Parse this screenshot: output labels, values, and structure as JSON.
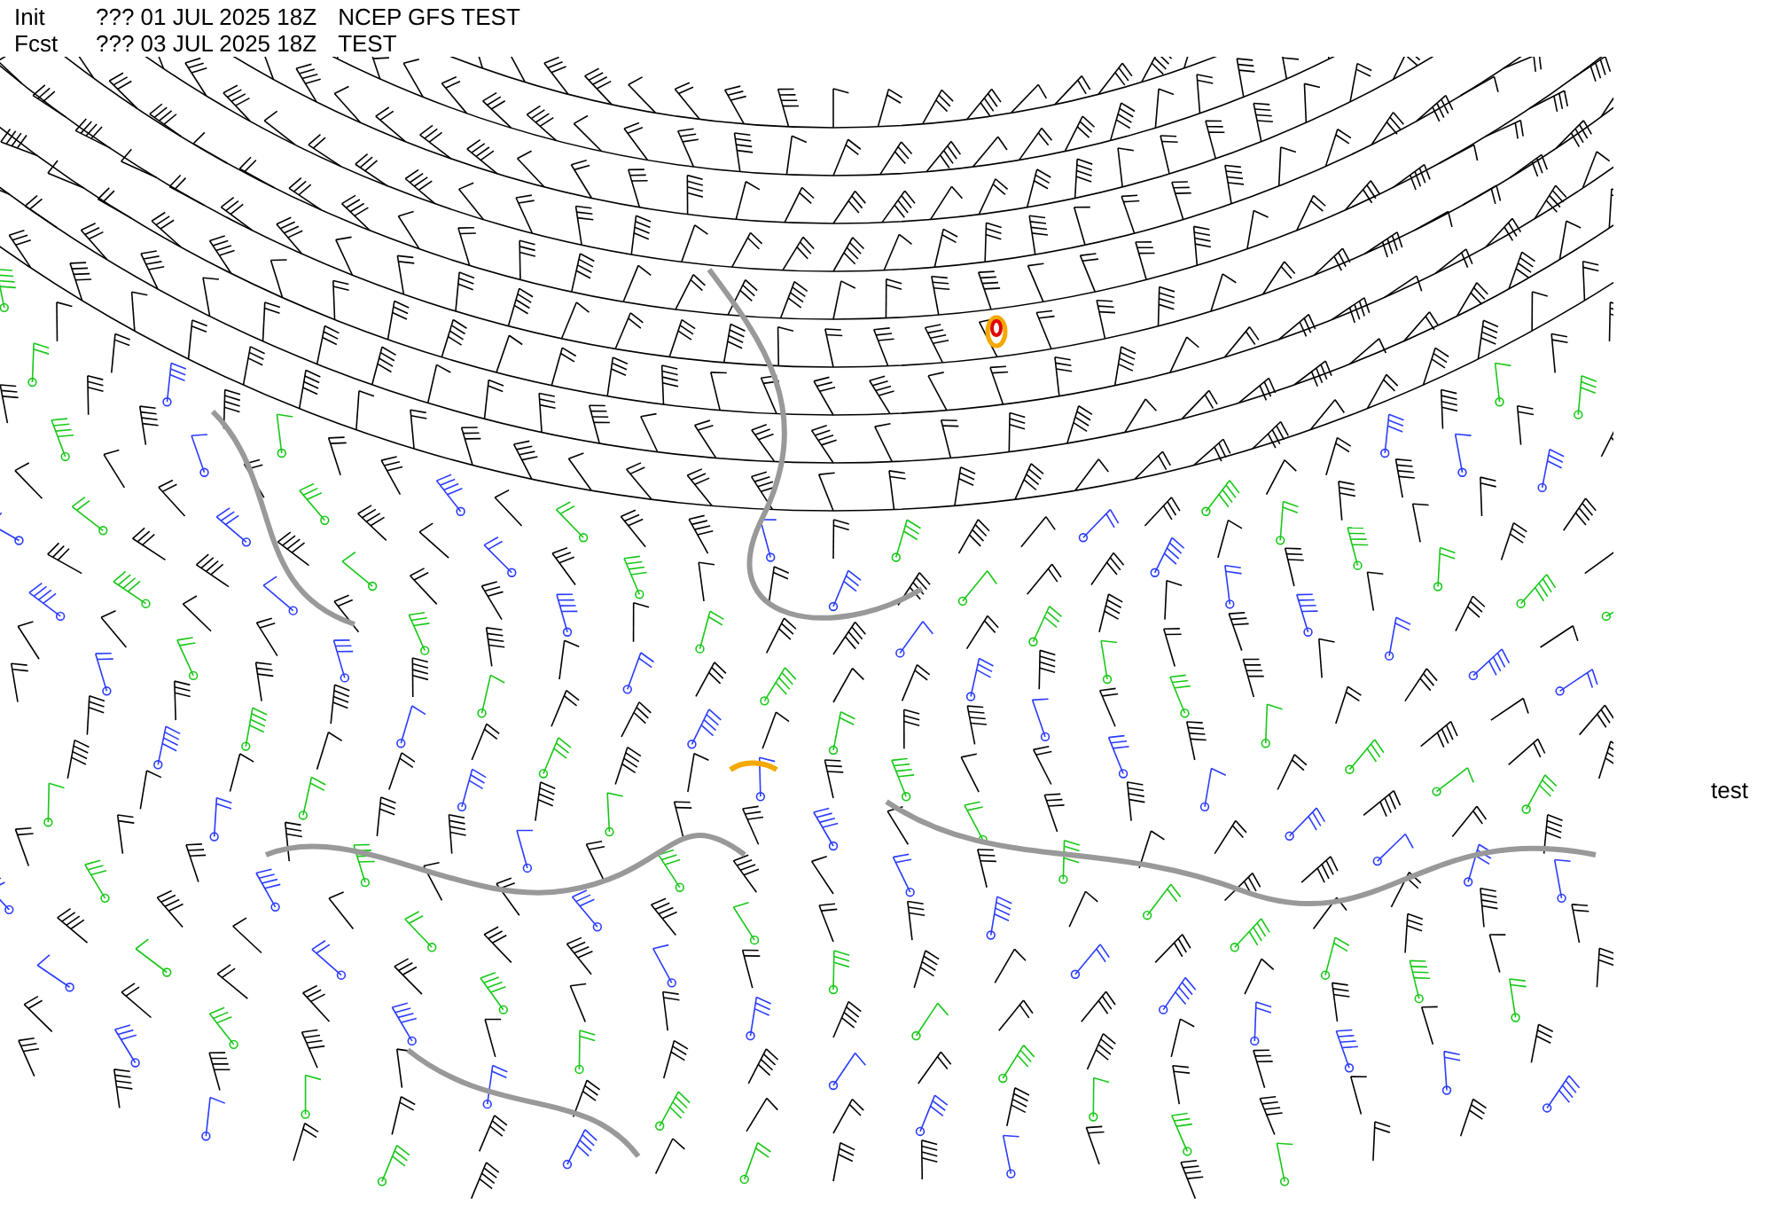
{
  "header": {
    "lines": [
      [
        "Init",
        "??? 01 JUL 2025 18Z",
        "NCEP GFS TEST"
      ],
      [
        "Fcst",
        "??? 03 JUL 2025 18Z",
        "TEST"
      ]
    ]
  },
  "side_label": "test"
}
